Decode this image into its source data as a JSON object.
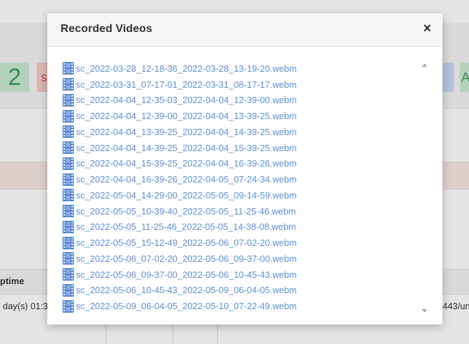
{
  "background": {
    "tile_number": "2",
    "tile_letter_red": "s",
    "tile_letter_green": "A",
    "table_header": "ptime",
    "row_left_text": "day(s) 01:3",
    "row_right_text": "443/un"
  },
  "modal": {
    "title": "Recorded Videos",
    "close_label": "×",
    "files": [
      "sc_2022-03-28_12-18-36_2022-03-28_13-19-20.webm",
      "sc_2022-03-31_07-17-01_2022-03-31_08-17-17.webm",
      "sc_2022-04-04_12-35-03_2022-04-04_12-39-00.webm",
      "sc_2022-04-04_12-39-00_2022-04-04_13-39-25.webm",
      "sc_2022-04-04_13-39-25_2022-04-04_14-39-25.webm",
      "sc_2022-04-04_14-39-25_2022-04-04_15-39-25.webm",
      "sc_2022-04-04_15-39-25_2022-04-04_16-39-26.webm",
      "sc_2022-04-04_16-39-26_2022-04-05_07-24-34.webm",
      "sc_2022-05-04_14-29-00_2022-05-05_09-14-59.webm",
      "sc_2022-05-05_10-39-40_2022-05-05_11-25-46.webm",
      "sc_2022-05-05_11-25-46_2022-05-05_14-38-08.webm",
      "sc_2022-05-05_15-12-49_2022-05-06_07-02-20.webm",
      "sc_2022-05-06_07-02-20_2022-05-06_09-37-00.webm",
      "sc_2022-05-06_09-37-00_2022-05-06_10-45-43.webm",
      "sc_2022-05-06_10-45-43_2022-05-09_06-04-05.webm",
      "sc_2022-05-09_06-04-05_2022-05-10_07-22-49.webm"
    ],
    "file_icon": "film-icon"
  },
  "colors": {
    "link": "#5b8fd6",
    "icon": "#4a7fd0"
  }
}
